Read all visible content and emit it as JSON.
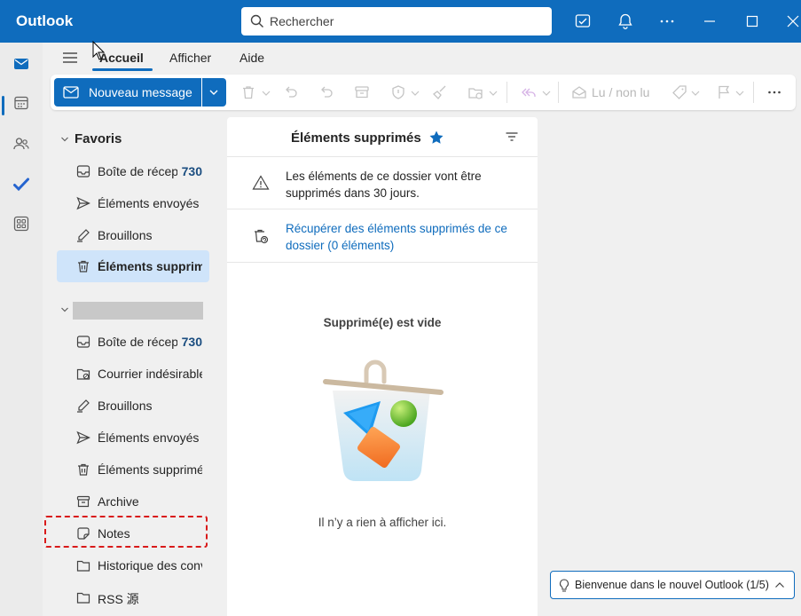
{
  "app": {
    "title": "Outlook"
  },
  "search": {
    "placeholder": "Rechercher"
  },
  "ribbon": {
    "tabs": [
      "Accueil",
      "Afficher",
      "Aide"
    ],
    "active_tab": "Accueil"
  },
  "toolbar": {
    "new_message_label": "Nouveau message",
    "read_unread_label": "Lu / non lu"
  },
  "folders": {
    "favorites_header": "Favoris",
    "favorites": [
      {
        "label": "Boîte de réception",
        "count": "730",
        "icon": "inbox-icon"
      },
      {
        "label": "Éléments envoyés",
        "icon": "sent-icon"
      },
      {
        "label": "Brouillons",
        "icon": "drafts-icon"
      },
      {
        "label": "Éléments supprimés",
        "icon": "trash-icon",
        "selected": true
      }
    ],
    "account": [
      {
        "label": "Boîte de réception",
        "count": "730",
        "icon": "inbox-icon"
      },
      {
        "label": "Courrier indésirable",
        "icon": "junk-icon"
      },
      {
        "label": "Brouillons",
        "icon": "drafts-icon"
      },
      {
        "label": "Éléments envoyés",
        "icon": "sent-icon"
      },
      {
        "label": "Éléments supprimés",
        "icon": "trash-icon"
      },
      {
        "label": "Archive",
        "icon": "archive-icon"
      },
      {
        "label": "Notes",
        "icon": "notes-icon"
      },
      {
        "label": "Historique des conversations",
        "icon": "folder-icon"
      },
      {
        "label": "RSS 源",
        "icon": "folder-icon"
      }
    ]
  },
  "list_pane": {
    "title": "Éléments supprimés",
    "info_text": "Les éléments de ce dossier vont être supprimés dans 30 jours.",
    "recover_link": "Récupérer des éléments supprimés de ce dossier (0 éléments)",
    "empty_title": "Supprimé(e) est vide",
    "empty_subtitle": "Il n’y a rien à afficher ici."
  },
  "toast": {
    "text": "Bienvenue dans le nouvel Outlook (1/5)"
  },
  "colors": {
    "brand": "#0f6cbd",
    "selected": "#cfe4fa",
    "highlight_box": "#d91a1a"
  }
}
